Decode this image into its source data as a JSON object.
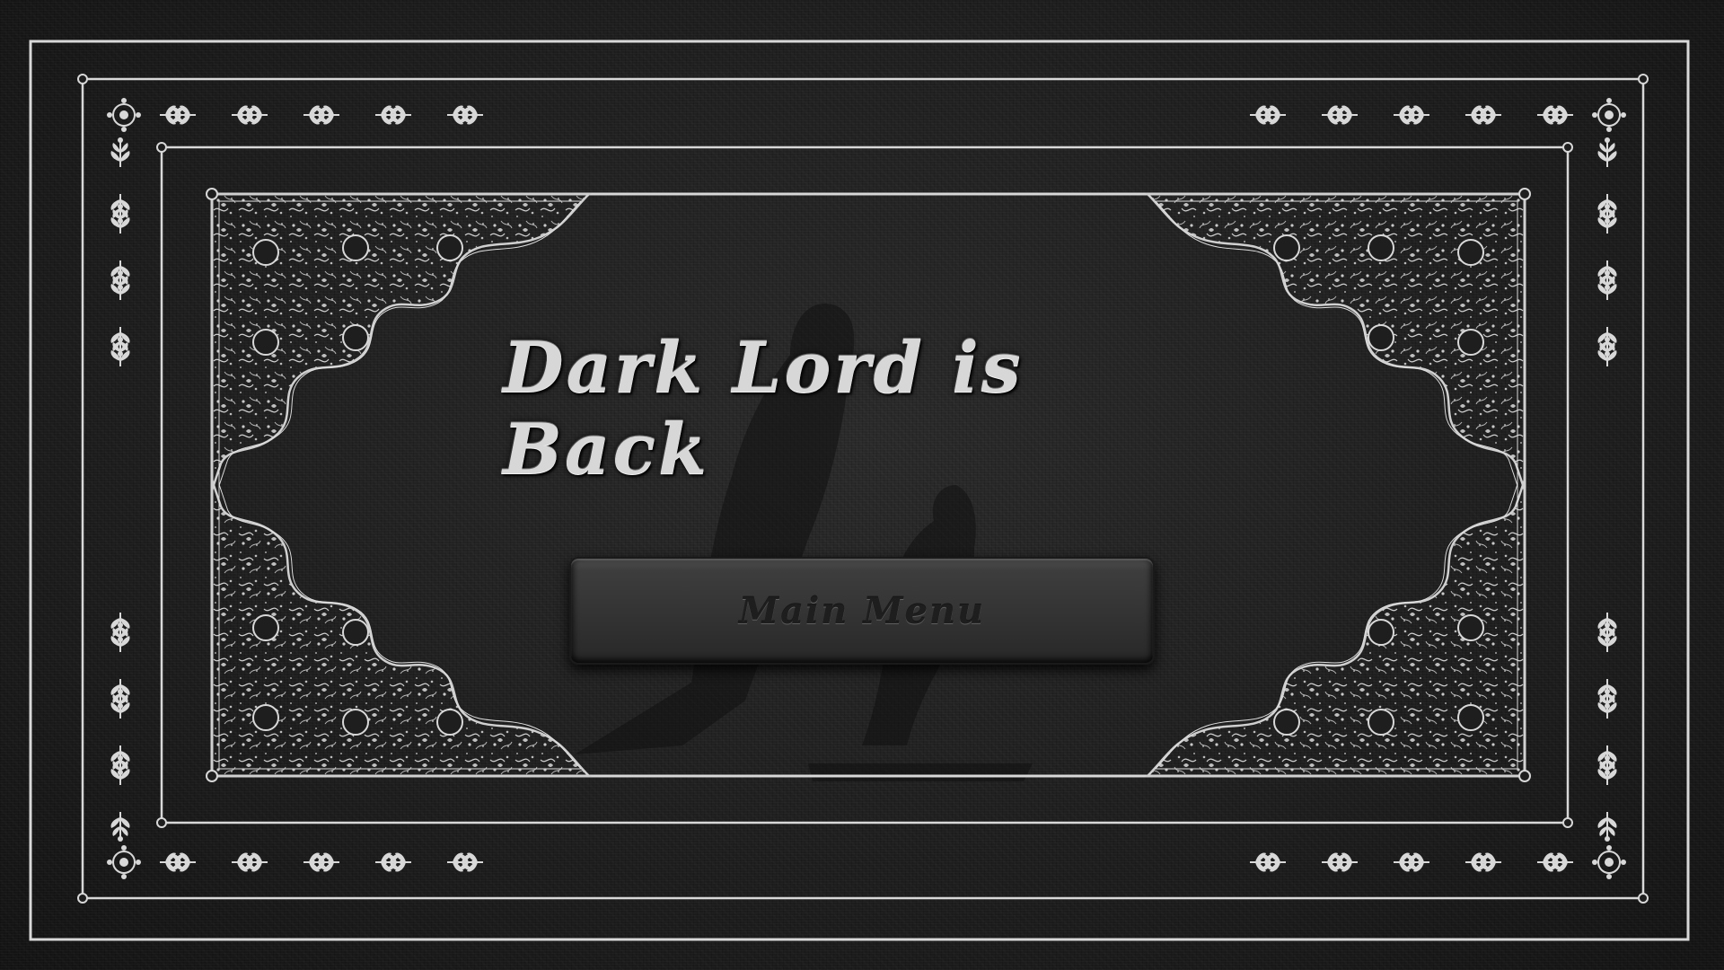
{
  "game": {
    "title": "Dark Lord is Back",
    "main_menu_label": "Main Menu"
  },
  "palette": {
    "background": "#222222",
    "line": "#d8d8d8",
    "button": "#3a3a3a"
  },
  "icons": {
    "corner_flourish": "floral-corner-filigree",
    "border_sprig": "leaf-sprig",
    "corner_rosette": "rosette"
  }
}
